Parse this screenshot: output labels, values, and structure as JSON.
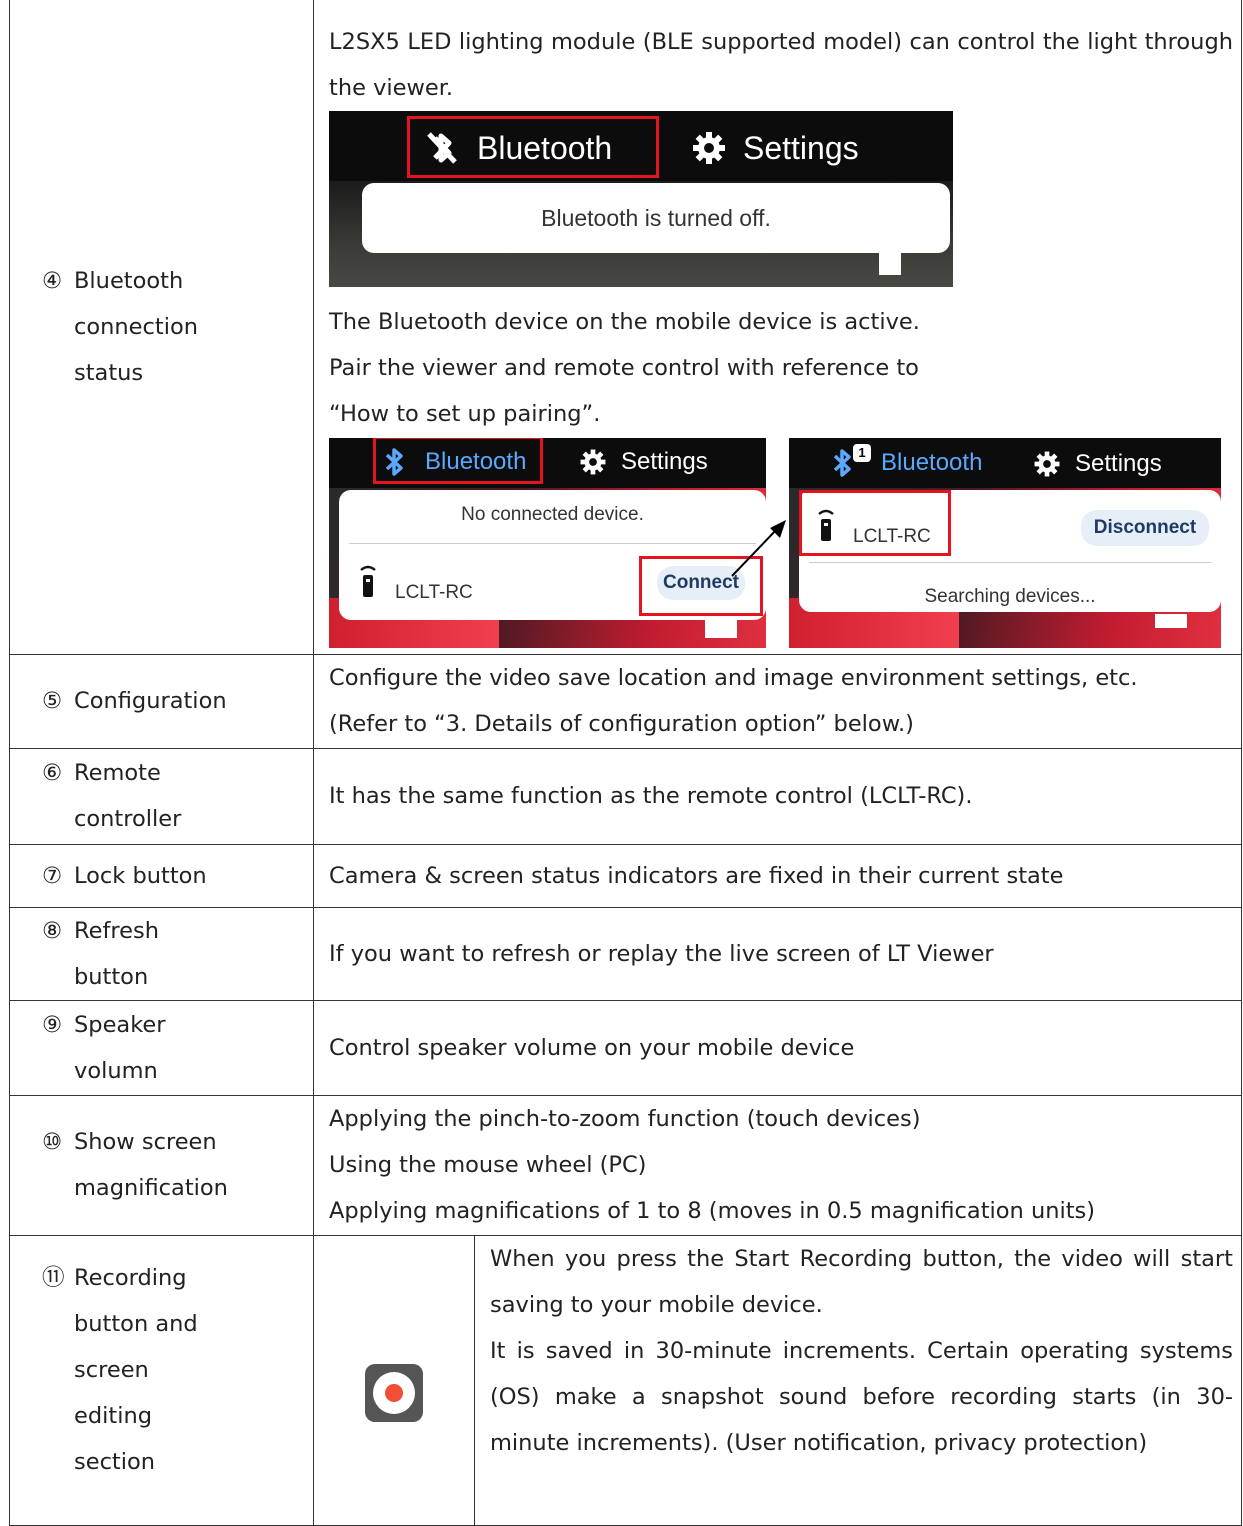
{
  "rows": [
    {
      "num": "④",
      "label": [
        "Bluetooth",
        "connection",
        "status"
      ],
      "desc_top": "L2SX5 LED lighting module (BLE supported model) can control the light through the viewer.",
      "shot1": {
        "bluetooth": "Bluetooth",
        "settings": "Settings",
        "message": "Bluetooth is turned off."
      },
      "desc_mid": [
        "The Bluetooth device on the mobile device is active.",
        "Pair the viewer and remote control with reference to",
        "“How to set up pairing”."
      ],
      "shot2": {
        "bluetooth": "Bluetooth",
        "settings": "Settings",
        "message": "No connected device.",
        "device": "LCLT-RC",
        "button": "Connect"
      },
      "shot3": {
        "bluetooth": "Bluetooth",
        "badge": "1",
        "settings": "Settings",
        "device": "LCLT-RC",
        "button": "Disconnect",
        "status": "Searching devices..."
      }
    },
    {
      "num": "⑤",
      "label": [
        "Configuration"
      ],
      "desc": [
        "Configure the video save location and image environment settings, etc.",
        "(Refer to “3. Details of configuration option” below.)"
      ]
    },
    {
      "num": "⑥",
      "label": [
        "Remote",
        "controller"
      ],
      "desc": [
        "It has the same function as the remote control (LCLT-RC)."
      ]
    },
    {
      "num": "⑦",
      "label": [
        "Lock button"
      ],
      "desc": [
        "Camera & screen status indicators are fixed in their current state"
      ]
    },
    {
      "num": "⑧",
      "label": [
        "Refresh",
        "button"
      ],
      "desc": [
        "If you want to refresh or replay the live screen of LT Viewer"
      ]
    },
    {
      "num": "⑨",
      "label": [
        "Speaker",
        "volumn"
      ],
      "desc": [
        "Control speaker volume on your mobile device"
      ]
    },
    {
      "num": "⑩",
      "label": [
        "Show screen",
        "magnification"
      ],
      "desc": [
        "Applying the pinch-to-zoom function (touch devices)",
        "Using the mouse wheel (PC)",
        "Applying magnifications of 1 to 8 (moves in 0.5 magnification units)"
      ]
    },
    {
      "num": "⑪",
      "label": [
        "Recording",
        "button and",
        "screen",
        "editing",
        "section"
      ],
      "icon": "record-icon",
      "desc_a": "When you press the Start Recording button, the video will start saving to your mobile device.",
      "desc_b": "It is saved in 30-minute increments. Certain operating systems (OS) make a snapshot sound before recording starts (in 30-minute increments). (User notification, privacy protection)"
    }
  ],
  "colors": {
    "highlight": "#e3141f",
    "bluetooth_active": "#5aa9ff",
    "record": "#f04e37"
  }
}
